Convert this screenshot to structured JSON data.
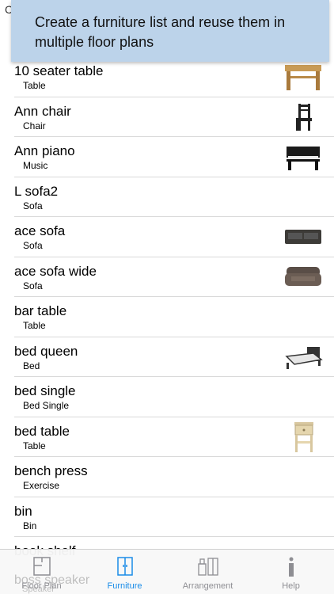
{
  "edge_letter": "C",
  "banner": {
    "text": "Create a furniture list and reuse them in multiple floor plans"
  },
  "items": [
    {
      "name": "10 seater table",
      "category": "Table",
      "icon": "table-wood-icon"
    },
    {
      "name": "Ann chair",
      "category": "Chair",
      "icon": "chair-icon"
    },
    {
      "name": "Ann piano",
      "category": "Music",
      "icon": "piano-icon"
    },
    {
      "name": "L sofa2",
      "category": "Sofa"
    },
    {
      "name": "ace sofa",
      "category": "Sofa",
      "icon": "sofa-icon"
    },
    {
      "name": "ace sofa wide",
      "category": "Sofa",
      "icon": "sofa-wide-icon"
    },
    {
      "name": "bar table",
      "category": "Table"
    },
    {
      "name": "bed queen",
      "category": "Bed",
      "icon": "bed-icon"
    },
    {
      "name": "bed single",
      "category": "Bed Single"
    },
    {
      "name": "bed table",
      "category": "Table",
      "icon": "nightstand-icon"
    },
    {
      "name": "bench press",
      "category": "Exercise"
    },
    {
      "name": "bin",
      "category": "Bin"
    },
    {
      "name": "book shelf",
      "category": ""
    }
  ],
  "ghost_row": {
    "name": "boss speaker",
    "category": "Speaker"
  },
  "tabs": [
    {
      "label": "Floor Plan",
      "icon": "floor-plan-icon",
      "active": false
    },
    {
      "label": "Furniture",
      "icon": "wardrobe-icon",
      "active": true
    },
    {
      "label": "Arrangement",
      "icon": "arrangement-icon",
      "active": false
    },
    {
      "label": "Help",
      "icon": "info-icon",
      "active": false
    }
  ],
  "colors": {
    "banner": "#bcd3ea",
    "accent": "#1a8ce8",
    "inactive": "#8e8e93"
  }
}
